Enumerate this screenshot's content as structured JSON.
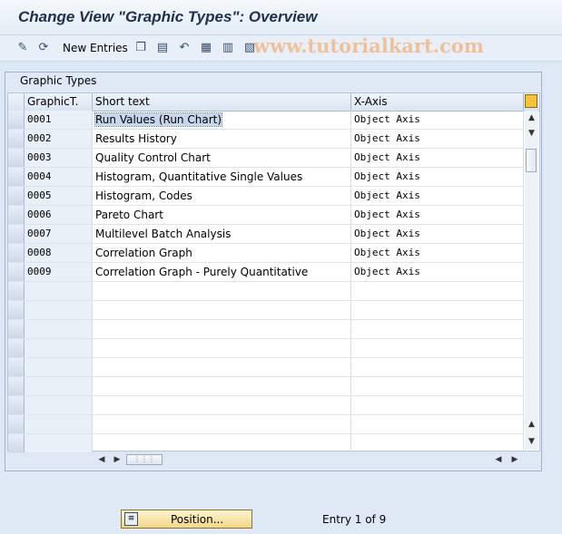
{
  "window": {
    "title": "Change View \"Graphic Types\": Overview"
  },
  "watermark": "www.tutorialkart.com",
  "toolbar": {
    "new_entries_label": "New Entries",
    "icons": [
      "display-change-icon",
      "refresh-icon",
      "copy-icon",
      "delete-icon",
      "undo-icon",
      "select-all-icon",
      "select-block-icon",
      "deselect-all-icon"
    ]
  },
  "panel": {
    "title": "Graphic Types"
  },
  "table": {
    "columns": [
      "GraphicT.",
      "Short text",
      "X-Axis"
    ],
    "rows": [
      {
        "code": "0001",
        "text": "Run Values (Run Chart)",
        "axis": "Object Axis"
      },
      {
        "code": "0002",
        "text": "Results History",
        "axis": "Object Axis"
      },
      {
        "code": "0003",
        "text": "Quality Control Chart",
        "axis": "Object Axis"
      },
      {
        "code": "0004",
        "text": "Histogram, Quantitative Single Values",
        "axis": "Object Axis"
      },
      {
        "code": "0005",
        "text": "Histogram, Codes",
        "axis": "Object Axis"
      },
      {
        "code": "0006",
        "text": "Pareto Chart",
        "axis": "Object Axis"
      },
      {
        "code": "0007",
        "text": "Multilevel Batch Analysis",
        "axis": "Object Axis"
      },
      {
        "code": "0008",
        "text": "Correlation Graph",
        "axis": "Object Axis"
      },
      {
        "code": "0009",
        "text": "Correlation Graph - Purely Quantitative",
        "axis": "Object Axis"
      }
    ]
  },
  "footer": {
    "position_label": "Position...",
    "entry_info": "Entry 1 of 9"
  },
  "colors": {
    "header_bg": "#dbe5f1",
    "selection": "#c7d6ea",
    "button": "#f2d58a"
  }
}
